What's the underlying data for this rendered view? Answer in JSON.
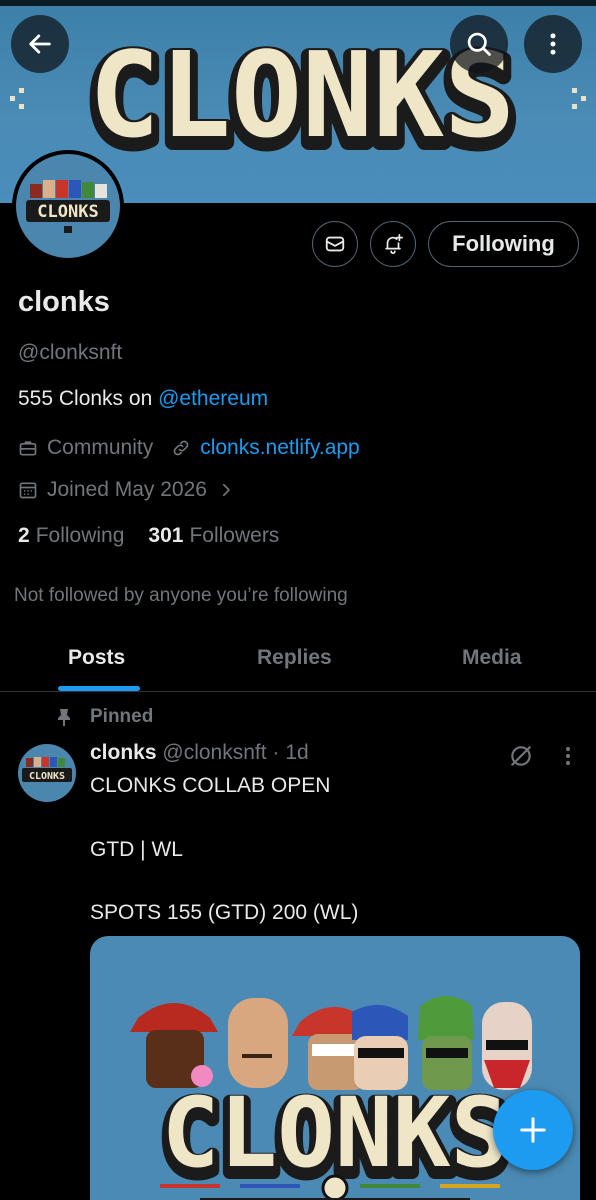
{
  "banner": {
    "logo_text": "CLONKS"
  },
  "profile": {
    "avatar_text": "CLONKS",
    "name": "clonks",
    "handle": "@clonksnft",
    "bio_prefix": "555 Clonks on ",
    "bio_mention": "@ethereum",
    "category": "Community",
    "website": "clonks.netlify.app",
    "joined": "Joined May 2026",
    "following_count": "2",
    "following_label": "Following",
    "followers_count": "301",
    "followers_label": "Followers",
    "not_followed_text": "Not followed by anyone you’re following"
  },
  "actions": {
    "follow_button_label": "Following"
  },
  "tabs": [
    {
      "label": "Posts",
      "active": true
    },
    {
      "label": "Replies",
      "active": false
    },
    {
      "label": "Media",
      "active": false
    }
  ],
  "post": {
    "pinned_label": "Pinned",
    "author_name": "clonks",
    "author_handle": "@clonksnft",
    "separator": "·",
    "time": "1d",
    "avatar_text": "CLONKS",
    "lines": [
      "CLONKS COLLAB OPEN",
      "GTD | WL",
      "SPOTS 155 (GTD) 200 (WL)"
    ],
    "image_text": "CLONKS"
  },
  "colors": {
    "accent": "#1d9bf0",
    "background": "#000000",
    "banner": "#4a8cb6",
    "muted_text": "#71767b"
  },
  "icons": [
    "back-arrow-icon",
    "search-icon",
    "more-vertical-icon",
    "mail-icon",
    "bell-plus-icon",
    "briefcase-icon",
    "link-icon",
    "calendar-icon",
    "chevron-right-icon",
    "pin-icon",
    "grok-icon",
    "plus-icon"
  ]
}
